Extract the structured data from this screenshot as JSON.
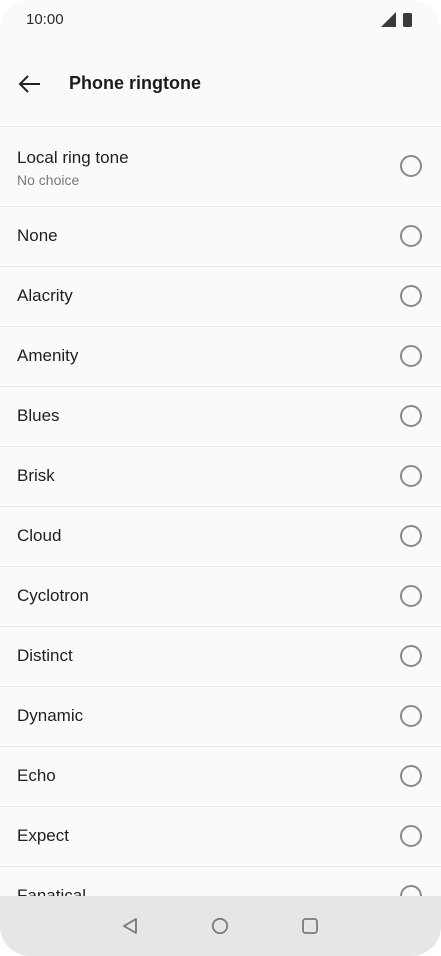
{
  "status_bar": {
    "time": "10:00",
    "icons": [
      "signal-icon",
      "battery-icon"
    ]
  },
  "header": {
    "title": "Phone ringtone",
    "back_icon": "arrow-left-icon"
  },
  "local_ringtone": {
    "label": "Local ring tone",
    "sublabel": "No choice"
  },
  "ringtones": [
    {
      "label": "None"
    },
    {
      "label": "Alacrity"
    },
    {
      "label": "Amenity"
    },
    {
      "label": "Blues"
    },
    {
      "label": "Brisk"
    },
    {
      "label": "Cloud"
    },
    {
      "label": "Cyclotron"
    },
    {
      "label": "Distinct"
    },
    {
      "label": "Dynamic"
    },
    {
      "label": "Echo"
    },
    {
      "label": "Expect"
    },
    {
      "label": "Fanatical"
    }
  ],
  "nav_bar": {
    "icons": [
      "back-triangle-icon",
      "home-circle-icon",
      "recents-square-icon"
    ]
  },
  "colors": {
    "background": "#fafafa",
    "divider": "#e8e8e8",
    "radio_border": "#8a8a8a",
    "nav_bar": "#e6e6e6"
  }
}
